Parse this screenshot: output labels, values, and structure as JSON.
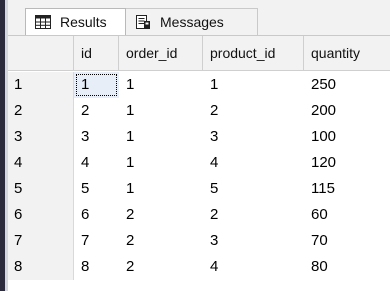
{
  "tabs": [
    {
      "label": "Results",
      "icon": "grid-icon"
    },
    {
      "label": "Messages",
      "icon": "messages-icon"
    }
  ],
  "grid": {
    "columns": [
      "id",
      "order_id",
      "product_id",
      "quantity"
    ],
    "rows": [
      {
        "num": "1",
        "cells": [
          "1",
          "1",
          "1",
          "250"
        ]
      },
      {
        "num": "2",
        "cells": [
          "2",
          "1",
          "2",
          "200"
        ]
      },
      {
        "num": "3",
        "cells": [
          "3",
          "1",
          "3",
          "100"
        ]
      },
      {
        "num": "4",
        "cells": [
          "4",
          "1",
          "4",
          "120"
        ]
      },
      {
        "num": "5",
        "cells": [
          "5",
          "1",
          "5",
          "115"
        ]
      },
      {
        "num": "6",
        "cells": [
          "6",
          "2",
          "2",
          "60"
        ]
      },
      {
        "num": "7",
        "cells": [
          "7",
          "2",
          "3",
          "70"
        ]
      },
      {
        "num": "8",
        "cells": [
          "8",
          "2",
          "4",
          "80"
        ]
      }
    ]
  }
}
